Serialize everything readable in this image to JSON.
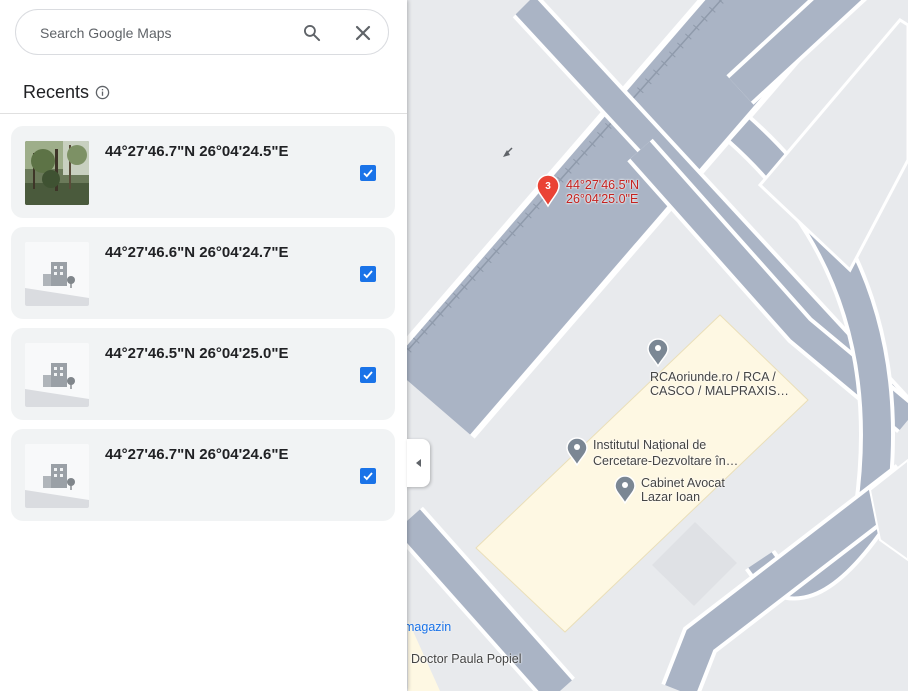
{
  "search": {
    "placeholder": "Search Google Maps",
    "search_icon": "search-icon",
    "close_icon": "close-icon"
  },
  "recents": {
    "title": "Recents",
    "info_icon": "info-icon",
    "items": [
      {
        "coords": "44°27'46.7\"N 26°04'24.5\"E",
        "thumb": "photo",
        "checked": true
      },
      {
        "coords": "44°27'46.6\"N 26°04'24.7\"E",
        "thumb": "building-placeholder",
        "checked": true
      },
      {
        "coords": "44°27'46.5\"N 26°04'25.0\"E",
        "thumb": "building-placeholder",
        "checked": true
      },
      {
        "coords": "44°27'46.7\"N 26°04'24.6\"E",
        "thumb": "building-placeholder",
        "checked": true
      }
    ]
  },
  "map": {
    "pin": {
      "number": "3",
      "lat": "44°27'46.5\"N",
      "lng": "26°04'25.0\"E"
    },
    "places": {
      "rca_line1": "RCAoriunde.ro / RCA /",
      "rca_line2": "CASCO / MALPRAXIS…",
      "inst_line1": "Institutul Național de",
      "inst_line2": "Cercetare-Dezvoltare în…",
      "cab_line1": "Cabinet Avocat",
      "cab_line2": "Lazar Ioan",
      "magazin": "magazin",
      "street": "Doctor Paula Popiel"
    },
    "colors": {
      "road": "#aab4c5",
      "road_edge": "#ffffff",
      "building": "#fef8e3",
      "block": "#e8eaed",
      "pin_red": "#ea4335"
    }
  }
}
